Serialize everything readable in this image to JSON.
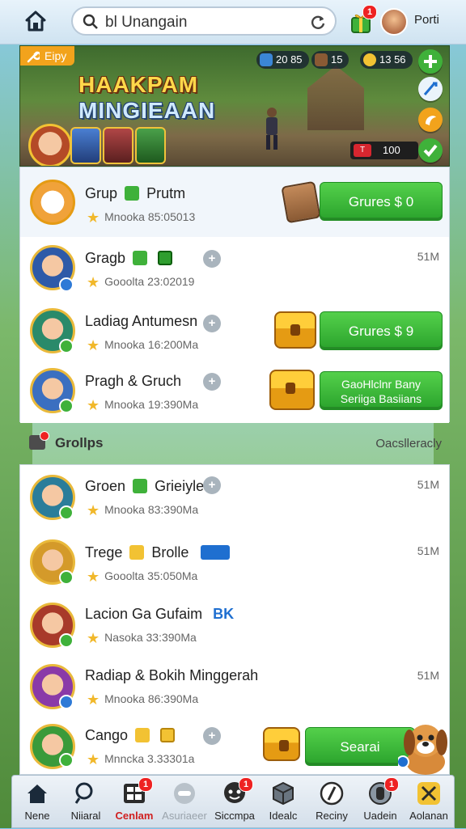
{
  "topbar": {
    "search_text": "bl Unangain",
    "gift_badge": "1",
    "profile_name": "Porti"
  },
  "banner": {
    "tag": "Eipy",
    "title_line1": "HAAKPAM",
    "title_line2": "MINGIEAAN",
    "hud_a": "20 85",
    "hud_b": "15",
    "hud_c": "13 56",
    "reward_flag": "T",
    "reward_value": "100"
  },
  "featured": [
    {
      "name": "Grup",
      "suffix": "Prutm",
      "sub": "Mnooka  85:05013",
      "button": "Grures $ 0"
    },
    {
      "name": "Gragb",
      "suffix": "",
      "sub": "Gooolta  23:02019",
      "right": "51M"
    },
    {
      "name": "Ladiag Antumesn",
      "suffix": "",
      "sub": "Mnooka  16:200Ma",
      "button": "Grures $ 9"
    },
    {
      "name": "Pragh & Gruch",
      "suffix": "",
      "sub": "Mnooka  19:390Ma",
      "button_line1": "GaoHlclnr Bany",
      "button_line2": "Seriiga Basiians"
    }
  ],
  "section": {
    "title": "Grollps",
    "right": "Oacslleracly"
  },
  "groups": [
    {
      "name": "Groen",
      "suffix": "Grieiyle",
      "sub": "Mnooka  83:390Ma",
      "right": "51M"
    },
    {
      "name": "Trege",
      "suffix": "Brolle",
      "sub": "Gooolta  35:050Ma",
      "right": "51M"
    },
    {
      "name": "Lacion Ga Gufaim",
      "suffix": "BK",
      "sub": "Nasoka  33:390Ma",
      "right": ""
    },
    {
      "name": "Radiap & Bokih Minggerah",
      "suffix": "",
      "sub": "Mnooka  86:390Ma",
      "right": "51M"
    },
    {
      "name": "Cango",
      "suffix": "",
      "sub": "Mnncka  3.33301a",
      "button": "Searai"
    }
  ],
  "nav": {
    "items": [
      {
        "label": "Nene"
      },
      {
        "label": "Niiaral"
      },
      {
        "label": "Cenlam",
        "badge": "1"
      },
      {
        "label": "Asuriaeer"
      },
      {
        "label": "Siccmpa",
        "badge": "1"
      },
      {
        "label": "Idealc"
      },
      {
        "label": "Reciny"
      },
      {
        "label": "Uadein",
        "badge": "1"
      },
      {
        "label": "Aolanan"
      }
    ]
  },
  "colors": {
    "accent_green": "#2aa32c",
    "badge_red": "#e22222",
    "gold": "#f2c233"
  }
}
